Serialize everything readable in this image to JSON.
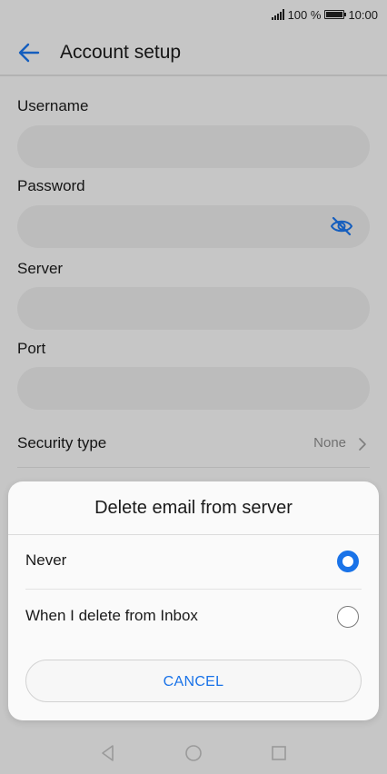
{
  "status": {
    "battery_percent": "100 %",
    "time": "10:00"
  },
  "header": {
    "title": "Account setup"
  },
  "form": {
    "username_label": "Username",
    "password_label": "Password",
    "server_label": "Server",
    "port_label": "Port",
    "security_label": "Security type",
    "security_value": "None"
  },
  "dialog": {
    "title": "Delete email from server",
    "options": [
      {
        "label": "Never",
        "selected": true
      },
      {
        "label": "When I delete from Inbox",
        "selected": false
      }
    ],
    "cancel_label": "CANCEL"
  },
  "colors": {
    "accent": "#1a73e8"
  },
  "icons": {
    "back": "arrow-left-icon",
    "eye": "eye-off-icon",
    "chevron": "chevron-right-icon",
    "nav_back": "triangle-back-icon",
    "nav_home": "circle-home-icon",
    "nav_recent": "square-recent-icon"
  }
}
